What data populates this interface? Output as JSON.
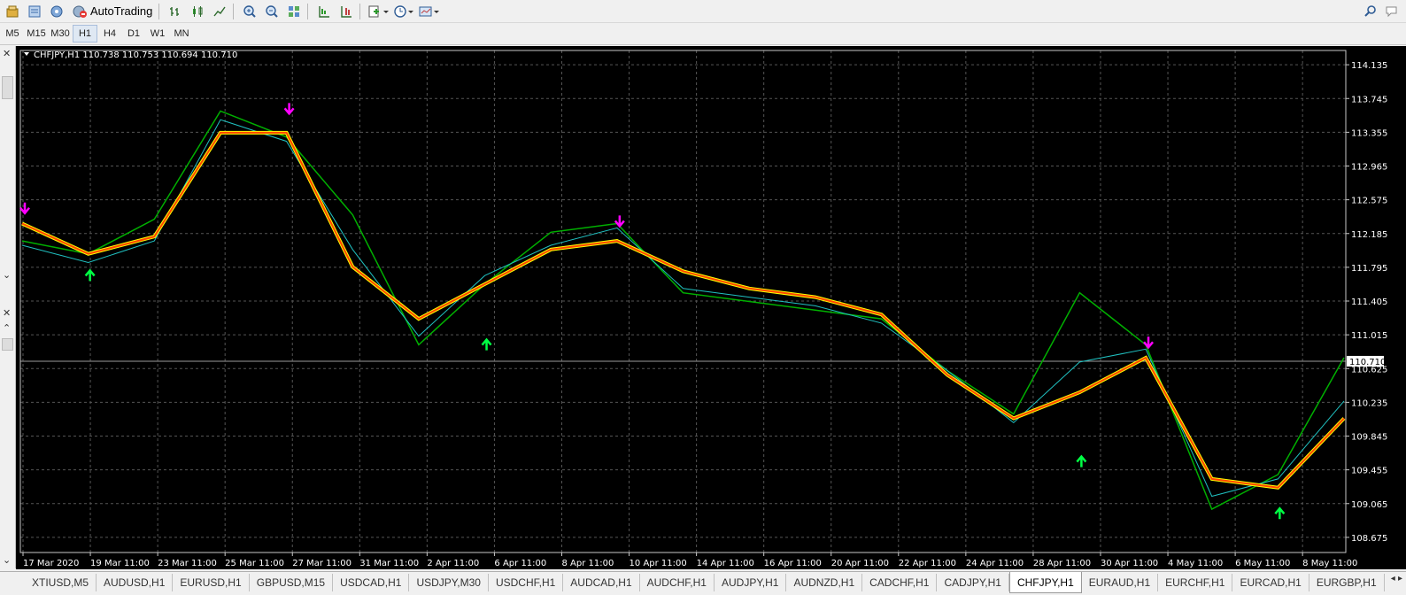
{
  "toolbar": {
    "autotrading_label": "AutoTrading"
  },
  "timeframes": [
    "M5",
    "M15",
    "M30",
    "H1",
    "H4",
    "D1",
    "W1",
    "MN"
  ],
  "active_timeframe": "H1",
  "chart": {
    "header": "CHFJPY,H1  110.738 110.753 110.694 110.710",
    "current_price_label": "110.710",
    "price_ticks": [
      "114.135",
      "113.745",
      "113.355",
      "112.965",
      "112.575",
      "112.185",
      "111.795",
      "111.405",
      "111.015",
      "110.625",
      "110.235",
      "109.845",
      "109.455",
      "109.065",
      "108.675"
    ],
    "time_ticks": [
      "17 Mar 2020",
      "19 Mar 11:00",
      "23 Mar 11:00",
      "25 Mar 11:00",
      "27 Mar 11:00",
      "31 Mar 11:00",
      "2 Apr 11:00",
      "6 Apr 11:00",
      "8 Apr 11:00",
      "10 Apr 11:00",
      "14 Apr 11:00",
      "16 Apr 11:00",
      "20 Apr 11:00",
      "22 Apr 11:00",
      "24 Apr 11:00",
      "28 Apr 11:00",
      "30 Apr 11:00",
      "4 May 11:00",
      "6 May 11:00",
      "8 May 11:00"
    ],
    "colors": {
      "background": "#000000",
      "price": "#00b000",
      "trail_outer": "#ffff00",
      "trail_inner": "#ff4500",
      "ma": "#20c0c0",
      "sell_arrow": "#ff00ff",
      "buy_arrow": "#00ff44",
      "grid": "#555555",
      "axis_text": "#ffffff"
    }
  },
  "chart_data": {
    "type": "line",
    "title": "CHFJPY,H1",
    "ohlc_last": {
      "open": 110.738,
      "high": 110.753,
      "low": 110.694,
      "close": 110.71
    },
    "ylim": [
      108.5,
      114.3
    ],
    "x": [
      "17 Mar 2020",
      "19 Mar 11:00",
      "23 Mar 11:00",
      "25 Mar 11:00",
      "27 Mar 11:00",
      "31 Mar 11:00",
      "2 Apr 11:00",
      "6 Apr 11:00",
      "8 Apr 11:00",
      "10 Apr 11:00",
      "14 Apr 11:00",
      "16 Apr 11:00",
      "20 Apr 11:00",
      "22 Apr 11:00",
      "24 Apr 11:00",
      "28 Apr 11:00",
      "30 Apr 11:00",
      "4 May 11:00",
      "6 May 11:00",
      "8 May 11:00",
      "8 May 16:00"
    ],
    "series": [
      {
        "values": [
          112.1,
          111.95,
          112.35,
          113.6,
          113.3,
          112.4,
          110.9,
          111.6,
          112.2,
          112.3,
          111.5,
          111.4,
          111.3,
          111.2,
          110.6,
          110.1,
          111.5,
          110.9,
          109.0,
          109.4,
          110.75
        ]
      },
      {
        "values": [
          112.3,
          111.95,
          112.15,
          113.35,
          113.35,
          111.8,
          111.2,
          111.6,
          112.0,
          112.1,
          111.75,
          111.55,
          111.45,
          111.25,
          110.55,
          110.05,
          110.35,
          110.75,
          109.35,
          109.25,
          110.05
        ]
      },
      {
        "values": [
          112.05,
          111.85,
          112.1,
          113.5,
          113.25,
          112.0,
          111.0,
          111.7,
          112.05,
          112.25,
          111.55,
          111.45,
          111.35,
          111.15,
          110.6,
          110.0,
          110.7,
          110.85,
          109.15,
          109.35,
          110.25
        ]
      }
    ],
    "sell_signals": [
      {
        "x": "17 Mar 2020",
        "price": 112.4
      },
      {
        "x": "27 Mar 11:00",
        "price": 113.55
      },
      {
        "x": "10 Apr 11:00",
        "price": 112.25
      },
      {
        "x": "4 May 11:00",
        "price": 110.85
      }
    ],
    "buy_signals": [
      {
        "x": "19 Mar 11:00",
        "price": 111.8
      },
      {
        "x": "6 Apr 11:00",
        "price": 111.0
      },
      {
        "x": "30 Apr 11:00",
        "price": 109.65
      },
      {
        "x": "8 May 11:00",
        "price": 109.05
      }
    ]
  },
  "tabs": [
    "XTIUSD,M5",
    "AUDUSD,H1",
    "EURUSD,H1",
    "GBPUSD,M15",
    "USDCAD,H1",
    "USDJPY,M30",
    "USDCHF,H1",
    "AUDCAD,H1",
    "AUDCHF,H1",
    "AUDJPY,H1",
    "AUDNZD,H1",
    "CADCHF,H1",
    "CADJPY,H1",
    "CHFJPY,H1",
    "EURAUD,H1",
    "EURCHF,H1",
    "EURCAD,H1",
    "EURGBP,H1"
  ],
  "active_tab": "CHFJPY,H1"
}
